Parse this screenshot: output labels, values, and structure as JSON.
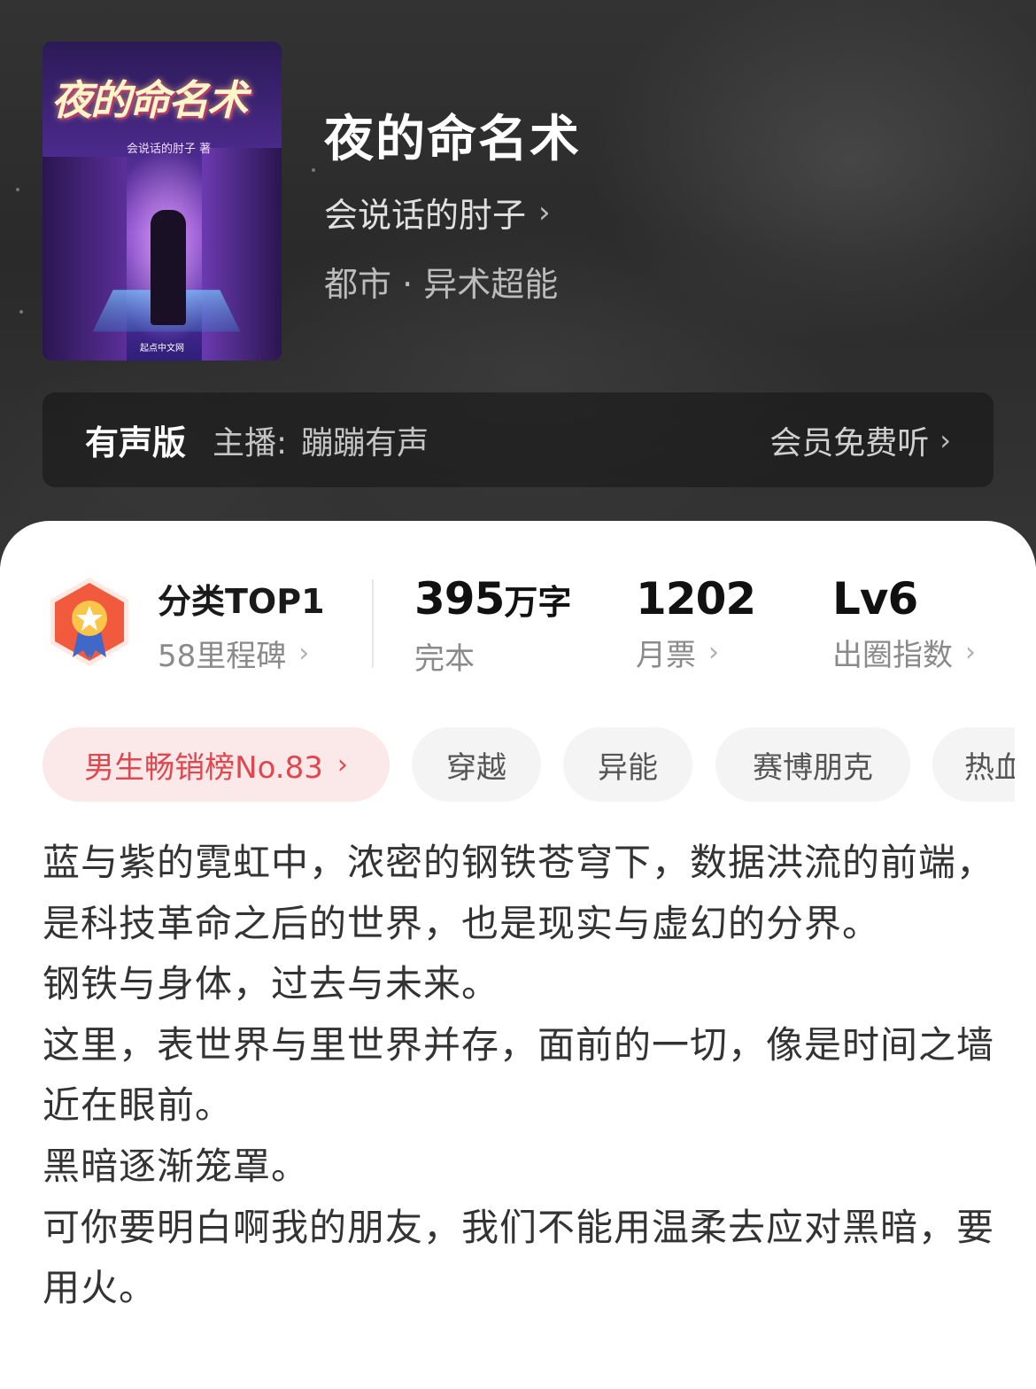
{
  "book": {
    "cover_title": "夜的命名术",
    "cover_author": "会说话的肘子 著",
    "cover_publisher": "起点中文网",
    "title": "夜的命名术",
    "author": "会说话的肘子",
    "genre": "都市 · 异术超能"
  },
  "audio": {
    "label": "有声版",
    "anchor_label": "主播:",
    "anchor_name": "蹦蹦有声",
    "listen_label": "会员免费听"
  },
  "stats": {
    "top": {
      "value": "分类TOP1",
      "sub": "58里程碑"
    },
    "words": {
      "value": "395",
      "unit": "万字",
      "sub": "完本"
    },
    "votes": {
      "value": "1202",
      "sub": "月票"
    },
    "level": {
      "value": "Lv6",
      "sub": "出圈指数"
    }
  },
  "tags": [
    {
      "label": "男生畅销榜No.83"
    },
    {
      "label": "穿越"
    },
    {
      "label": "异能"
    },
    {
      "label": "赛博朋克"
    },
    {
      "label": "热血"
    }
  ],
  "synopsis": [
    "蓝与紫的霓虹中，浓密的钢铁苍穹下，数据洪流的前端，是科技革命之后的世界，也是现实与虚幻的分界。",
    "钢铁与身体，过去与未来。",
    "这里，表世界与里世界并存，面前的一切，像是时间之墙近在眼前。",
    "黑暗逐渐笼罩。",
    "可你要明白啊我的朋友，我们不能用温柔去应对黑暗，要用火。"
  ],
  "colors": {
    "accent_red": "#e0474e",
    "rank_tag_bg": "#fbe8e8",
    "hero_bg": "#2f2f2f"
  },
  "icons": {
    "chevron": "chevron-right-icon",
    "badge": "medal-badge-icon"
  }
}
